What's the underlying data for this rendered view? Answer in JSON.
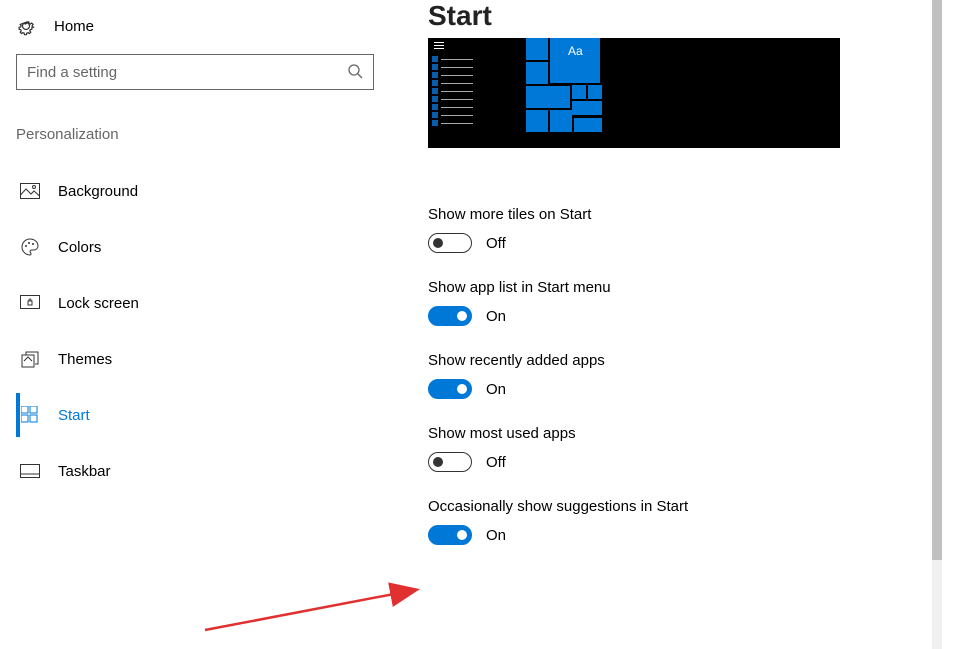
{
  "sidebar": {
    "home_label": "Home",
    "search_placeholder": "Find a setting",
    "section_title": "Personalization",
    "items": [
      {
        "id": "background",
        "label": "Background"
      },
      {
        "id": "colors",
        "label": "Colors"
      },
      {
        "id": "lockscreen",
        "label": "Lock screen"
      },
      {
        "id": "themes",
        "label": "Themes"
      },
      {
        "id": "start",
        "label": "Start",
        "active": true
      },
      {
        "id": "taskbar",
        "label": "Taskbar"
      }
    ]
  },
  "main": {
    "title": "Start",
    "preview_sample_text": "Aa",
    "settings": [
      {
        "label": "Show more tiles on Start",
        "state": "Off",
        "on": false
      },
      {
        "label": "Show app list in Start menu",
        "state": "On",
        "on": true
      },
      {
        "label": "Show recently added apps",
        "state": "On",
        "on": true
      },
      {
        "label": "Show most used apps",
        "state": "Off",
        "on": false
      },
      {
        "label": "Occasionally show suggestions in Start",
        "state": "On",
        "on": true
      }
    ]
  },
  "colors": {
    "accent": "#0078d7"
  }
}
